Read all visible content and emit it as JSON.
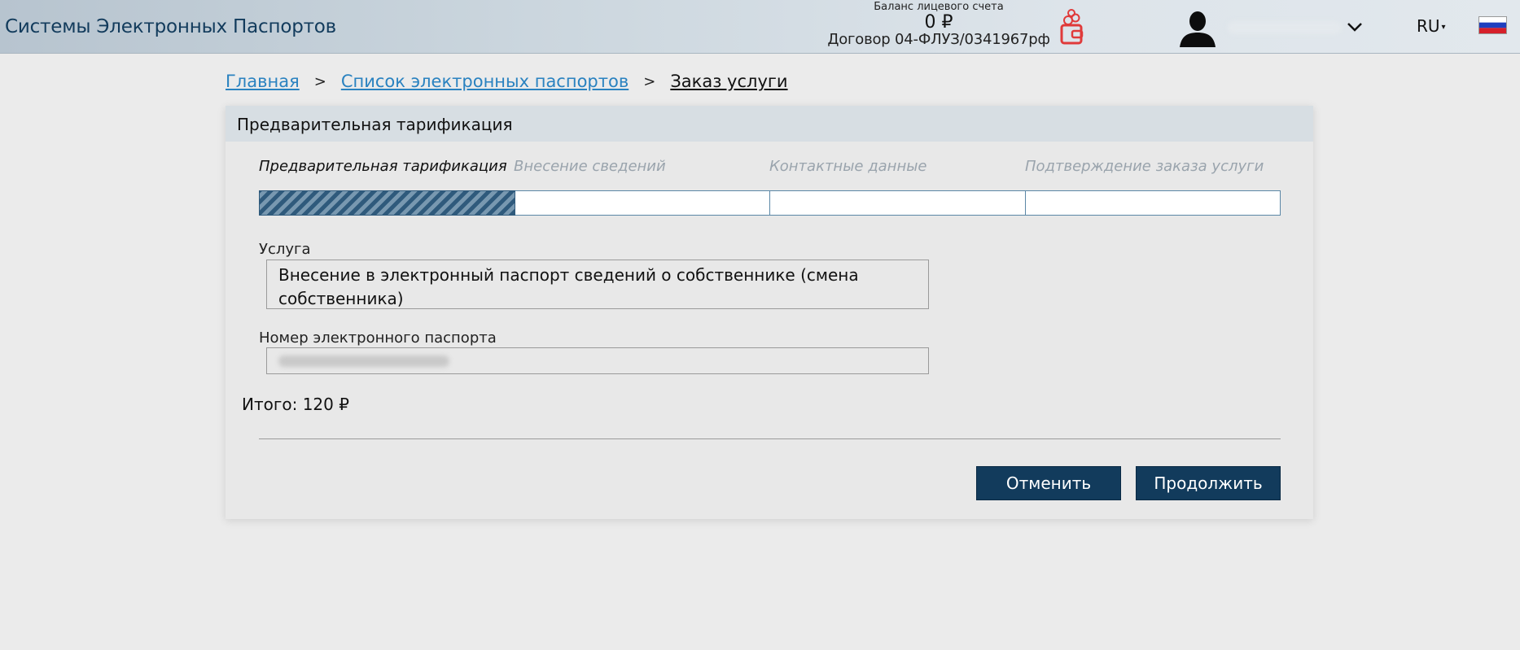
{
  "header": {
    "app_title": "Системы Электронных Паспортов",
    "balance_label": "Баланс лицевого счета",
    "balance_amount": "0 ₽",
    "contract": "Договор 04-ФЛУЗ/0341967рф",
    "language": "RU",
    "icons": [
      "wallet-icon",
      "avatar-icon",
      "chevron-down-icon",
      "flag-icon"
    ]
  },
  "breadcrumb": {
    "home": "Главная",
    "list": "Список электронных паспортов",
    "current": "Заказ услуги",
    "separator": ">"
  },
  "card": {
    "title": "Предварительная тарификация",
    "steps": [
      {
        "label": "Предварительная тарификация",
        "status": "active"
      },
      {
        "label": "Внесение сведений",
        "status": "pending"
      },
      {
        "label": "Контактные данные",
        "status": "pending"
      },
      {
        "label": "Подтверждение заказа услуги",
        "status": "pending"
      }
    ],
    "service_label": "Услуга",
    "service_value": "Внесение в электронный паспорт сведений о собственнике (смена собственника)",
    "passport_label": "Номер электронного паспорта",
    "total": "Итого: 120 ₽"
  },
  "buttons": {
    "cancel": "Отменить",
    "continue": "Продолжить"
  },
  "colors": {
    "primary": "#123b5c",
    "link": "#2a82c0",
    "accent_red": "#e03a3a",
    "progress_stripe": "#2f5a7c"
  }
}
